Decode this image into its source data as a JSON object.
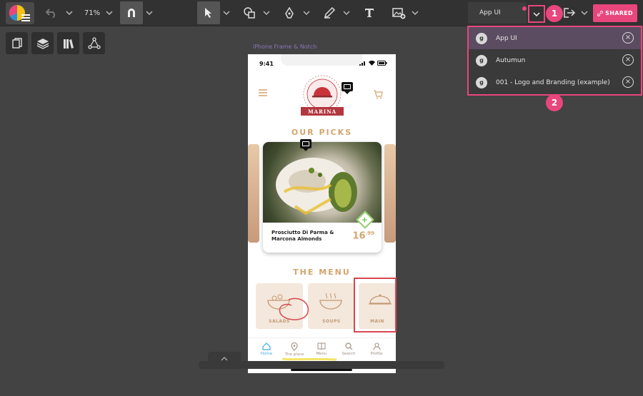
{
  "toolbar": {
    "zoom": "71%",
    "document_name": "App UI",
    "shared_label": "SHARED"
  },
  "markers": {
    "one": "1",
    "two": "2"
  },
  "documents": [
    {
      "name": "App UI",
      "active": true
    },
    {
      "name": "Autumun",
      "active": false
    },
    {
      "name": "001 - Logo and Branding (example)",
      "active": false
    }
  ],
  "canvas": {
    "frame_label": "iPhone Frame & Notch"
  },
  "app": {
    "status_time": "9:41",
    "brand": "MARINA",
    "our_picks_title": "OUR PICKS",
    "dish_name": "Prosciutto Di Parma & Marcona Almonds",
    "price_main": "16",
    "price_cents": ".99",
    "menu_title": "THE MENU",
    "menu_tiles": [
      "SALADS",
      "SOUPS",
      "MAIN"
    ],
    "nav": [
      "Home",
      "The place",
      "Menu",
      "Search",
      "Profile"
    ]
  },
  "colors": {
    "accent": "#e8467c",
    "gold": "#d4a46c",
    "brand_red": "#b3373f",
    "nav_active": "#3fa9e0"
  }
}
